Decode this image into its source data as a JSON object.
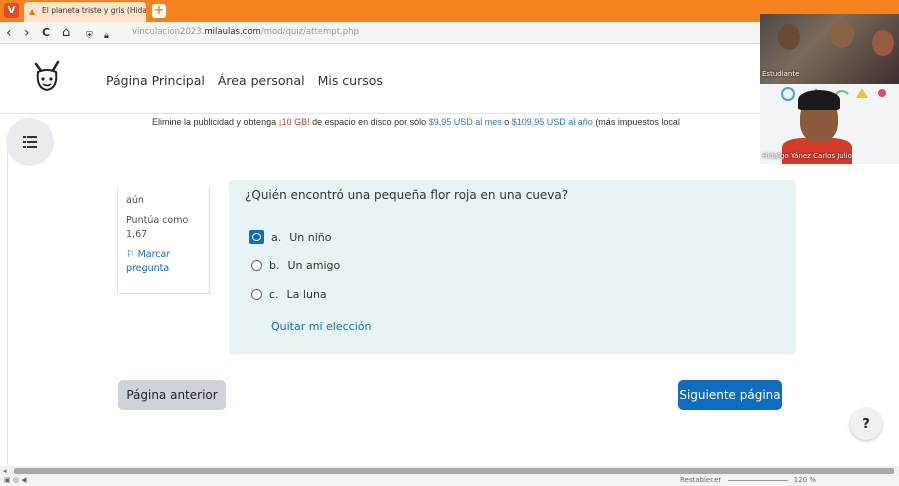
{
  "browser": {
    "logo_glyph": "V",
    "tab_title": "El planeta triste y gris (Hidalgo",
    "new_tab_glyph": "+",
    "url_prefix": "vinculacion2023.",
    "url_domain": "milaulas.com",
    "url_path": "/mod/quiz/attempt.php",
    "back_glyph": "‹",
    "forward_glyph": "›",
    "reload_glyph": "C",
    "home_glyph": "⌂"
  },
  "nav": {
    "items": [
      "Página Principal",
      "Área personal",
      "Mis cursos"
    ]
  },
  "ad": {
    "prefix": "Elimine la publicidad y obtenga ",
    "highlight": "¡10 GB!",
    "middle": " de espacio en disco por sólo ",
    "price_month": "$9,95 USD al mes",
    "or": " o ",
    "price_year": "$109,95 USD al año",
    "suffix": " (más impuestos local"
  },
  "question_info": {
    "status_fragment": "aún",
    "score_label": "Puntúa como",
    "score_value": "1,67",
    "flag_label_1": "Marcar",
    "flag_label_2": "pregunta"
  },
  "question": {
    "text": "¿Quién encontró una pequeña flor roja en una cueva?",
    "options": [
      {
        "letter": "a.",
        "text": "Un niño",
        "selected": true
      },
      {
        "letter": "b.",
        "text": "Un amigo",
        "selected": false
      },
      {
        "letter": "c.",
        "text": "La luna",
        "selected": false
      }
    ],
    "clear_label": "Quitar mi elección"
  },
  "buttons": {
    "prev": "Página anterior",
    "next": "Siguiente página",
    "help": "?"
  },
  "status": {
    "zoom_label": "Restablecer",
    "zoom_value": "120 %"
  },
  "video": {
    "participant1": "Estudiante",
    "participant2": "Hidalgo Yánez Carlos Julio"
  },
  "colors": {
    "brand_orange": "#f5821f",
    "primary_blue": "#0f6cbf",
    "question_bg": "#e7f3f5"
  }
}
